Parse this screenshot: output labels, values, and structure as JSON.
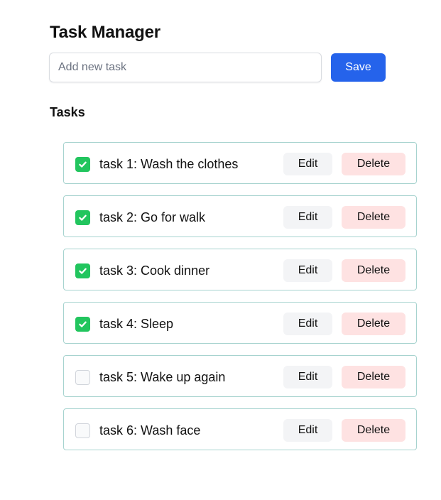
{
  "header": {
    "title": "Task Manager"
  },
  "add_task": {
    "placeholder": "Add new task",
    "value": "",
    "save_label": "Save"
  },
  "tasks_section": {
    "title": "Tasks",
    "items": [
      {
        "text": "task 1: Wash the clothes",
        "completed": true,
        "edit_label": "Edit",
        "delete_label": "Delete"
      },
      {
        "text": "task 2: Go for walk",
        "completed": true,
        "edit_label": "Edit",
        "delete_label": "Delete"
      },
      {
        "text": "task 3: Cook dinner",
        "completed": true,
        "edit_label": "Edit",
        "delete_label": "Delete"
      },
      {
        "text": "task 4: Sleep",
        "completed": true,
        "edit_label": "Edit",
        "delete_label": "Delete"
      },
      {
        "text": "task 5: Wake up again",
        "completed": false,
        "edit_label": "Edit",
        "delete_label": "Delete"
      },
      {
        "text": "task 6: Wash face",
        "completed": false,
        "edit_label": "Edit",
        "delete_label": "Delete"
      }
    ]
  },
  "colors": {
    "primary": "#2563eb",
    "check": "#22c55e",
    "task_border": "#a7d3cf",
    "edit_bg": "#f3f4f6",
    "delete_bg": "#fee2e2"
  },
  "icons": {
    "checked": "check-icon"
  }
}
